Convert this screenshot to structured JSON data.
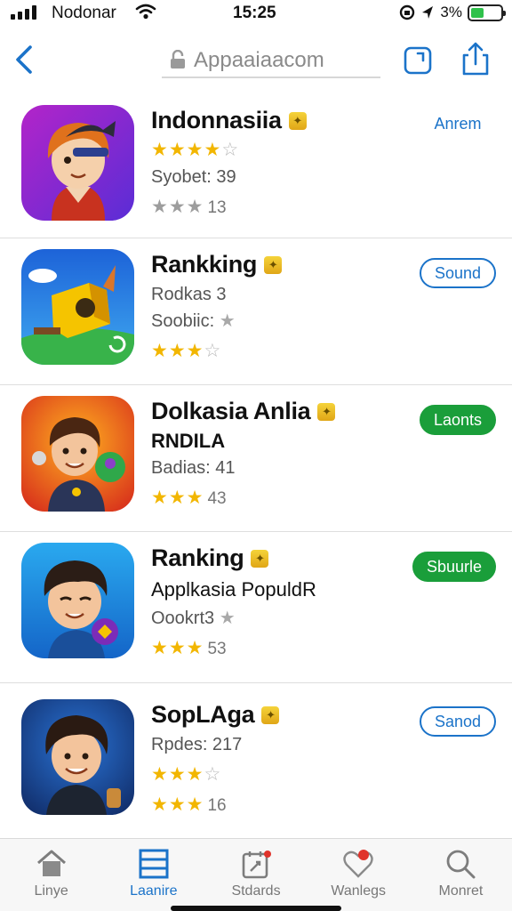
{
  "status_bar": {
    "carrier": "Nodonar",
    "time": "15:25",
    "battery_text": "3%"
  },
  "nav": {
    "url": "Appaaiaacom"
  },
  "apps": [
    {
      "title": "Indonnasiia",
      "lines": [
        {
          "text": "Syobet: 39",
          "style": "muted"
        }
      ],
      "stars": [
        {
          "filled": 4,
          "empty": 1,
          "count": ""
        },
        {
          "filled": 0,
          "empty": 3,
          "count": "13",
          "grey": true
        }
      ],
      "action": {
        "label": "Anrem",
        "style": "text"
      }
    },
    {
      "title": "Rankking",
      "lines": [
        {
          "text": "Rodkas 3",
          "style": "muted"
        },
        {
          "text": "Soobiic:",
          "style": "muted"
        }
      ],
      "stars": [
        {
          "filled": 3,
          "empty": 1,
          "count": ""
        }
      ],
      "action": {
        "label": "Sound",
        "style": "outline"
      }
    },
    {
      "title": "Dolkasia Anlia",
      "lines": [
        {
          "text": "RNDILA",
          "style": "dark"
        },
        {
          "text": "Badias: 41",
          "style": "muted"
        }
      ],
      "stars": [
        {
          "filled": 3,
          "empty": 0,
          "count": "43"
        }
      ],
      "action": {
        "label": "Laonts",
        "style": "filled"
      }
    },
    {
      "title": "Ranking",
      "lines": [
        {
          "text": "Applkasia PopuldR",
          "style": "dark"
        },
        {
          "text": "Oookrt3",
          "style": "muted"
        }
      ],
      "stars": [
        {
          "filled": 3,
          "empty": 0,
          "count": "53"
        }
      ],
      "action": {
        "label": "Sbuurle",
        "style": "filled"
      }
    },
    {
      "title": "SopLAga",
      "lines": [
        {
          "text": "Rpdes: 217",
          "style": "muted"
        }
      ],
      "stars": [
        {
          "filled": 3,
          "empty": 1,
          "count": ""
        },
        {
          "filled": 3,
          "empty": 0,
          "count": "16"
        }
      ],
      "action": {
        "label": "Sanod",
        "style": "outline"
      }
    }
  ],
  "tabs": [
    {
      "label": "Linye",
      "icon": "home-icon",
      "active": false
    },
    {
      "label": "Laanire",
      "icon": "list-icon",
      "active": true
    },
    {
      "label": "Stdards",
      "icon": "calendar-icon",
      "active": false
    },
    {
      "label": "Wanlegs",
      "icon": "heart-icon",
      "active": false
    },
    {
      "label": "Monret",
      "icon": "search-icon",
      "active": false
    }
  ],
  "colors": {
    "accent": "#1b73c9",
    "green": "#1a9e3a",
    "star": "#f2b600"
  }
}
